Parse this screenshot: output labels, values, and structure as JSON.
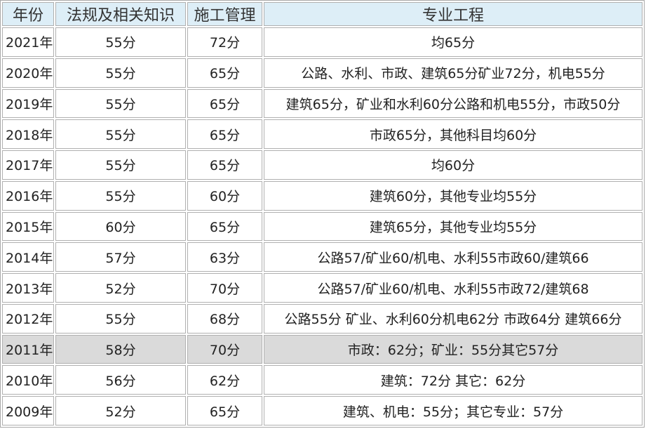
{
  "headers": [
    "年份",
    "法规及相关知识",
    "施工管理",
    "专业工程"
  ],
  "rows": [
    [
      "2021年",
      "55分",
      "72分",
      "均65分"
    ],
    [
      "2020年",
      "55分",
      "65分",
      "公路、水利、市政、建筑65分矿业72分，机电55分"
    ],
    [
      "2019年",
      "55分",
      "65分",
      "建筑65分，矿业和水利60分公路和机电55分，市政50分"
    ],
    [
      "2018年",
      "55分",
      "65分",
      "市政65分，其他科目均60分"
    ],
    [
      "2017年",
      "55分",
      "65分",
      "均60分"
    ],
    [
      "2016年",
      "55分",
      "60分",
      "建筑60分，其他专业均55分"
    ],
    [
      "2015年",
      "60分",
      "65分",
      "建筑65分，其他专业均55分"
    ],
    [
      "2014年",
      "57分",
      "63分",
      "公路57/矿业60/机电、水利55市政60/建筑66"
    ],
    [
      "2013年",
      "52分",
      "70分",
      "公路57/矿业60/机电、水利55市政72/建筑68"
    ],
    [
      "2012年",
      "55分",
      "68分",
      "公路55分 矿业、水利60分机电62分 市政64分 建筑66分"
    ],
    [
      "2011年",
      "58分",
      "70分",
      "市政：62分；矿业：55分其它57分"
    ],
    [
      "2010年",
      "56分",
      "62分",
      "建筑：72分 其它：62分"
    ],
    [
      "2009年",
      "52分",
      "65分",
      "建筑、机电：55分；其它专业：57分"
    ]
  ],
  "highlight_row": "2011年"
}
